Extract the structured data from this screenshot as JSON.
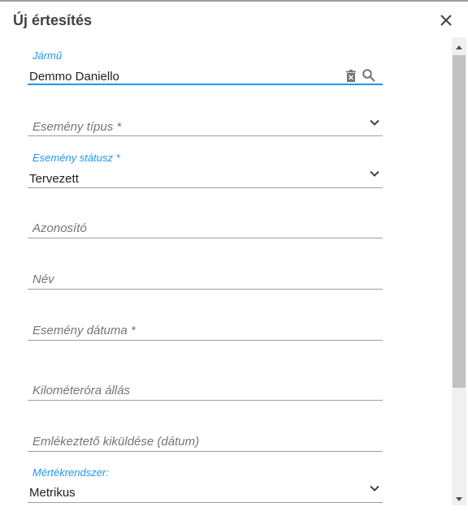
{
  "dialog": {
    "title": "Új értesítés",
    "close_icon": "close-icon"
  },
  "form": {
    "vehicle": {
      "label": "Jármű",
      "value": "Demmo Daniello",
      "clear_icon": "trash-icon",
      "search_icon": "search-icon"
    },
    "event_type": {
      "placeholder": "Esemény típus",
      "required_marker": "*"
    },
    "event_status": {
      "label": "Esemény státusz",
      "required_marker": "*",
      "value": "Tervezett"
    },
    "identifier": {
      "placeholder": "Azonosító"
    },
    "name": {
      "placeholder": "Név"
    },
    "event_date": {
      "placeholder": "Esemény dátuma",
      "required_marker": "*"
    },
    "odometer": {
      "placeholder": "Kilométeróra állás"
    },
    "reminder_date": {
      "placeholder": "Emlékeztető kiküldése (dátum)"
    },
    "unit_system": {
      "label": "Mértékrendszer:",
      "value": "Metrikus"
    }
  },
  "colors": {
    "accent": "#2196f3",
    "text": "#212121",
    "placeholder": "#757575",
    "divider": "#9e9e9e"
  }
}
